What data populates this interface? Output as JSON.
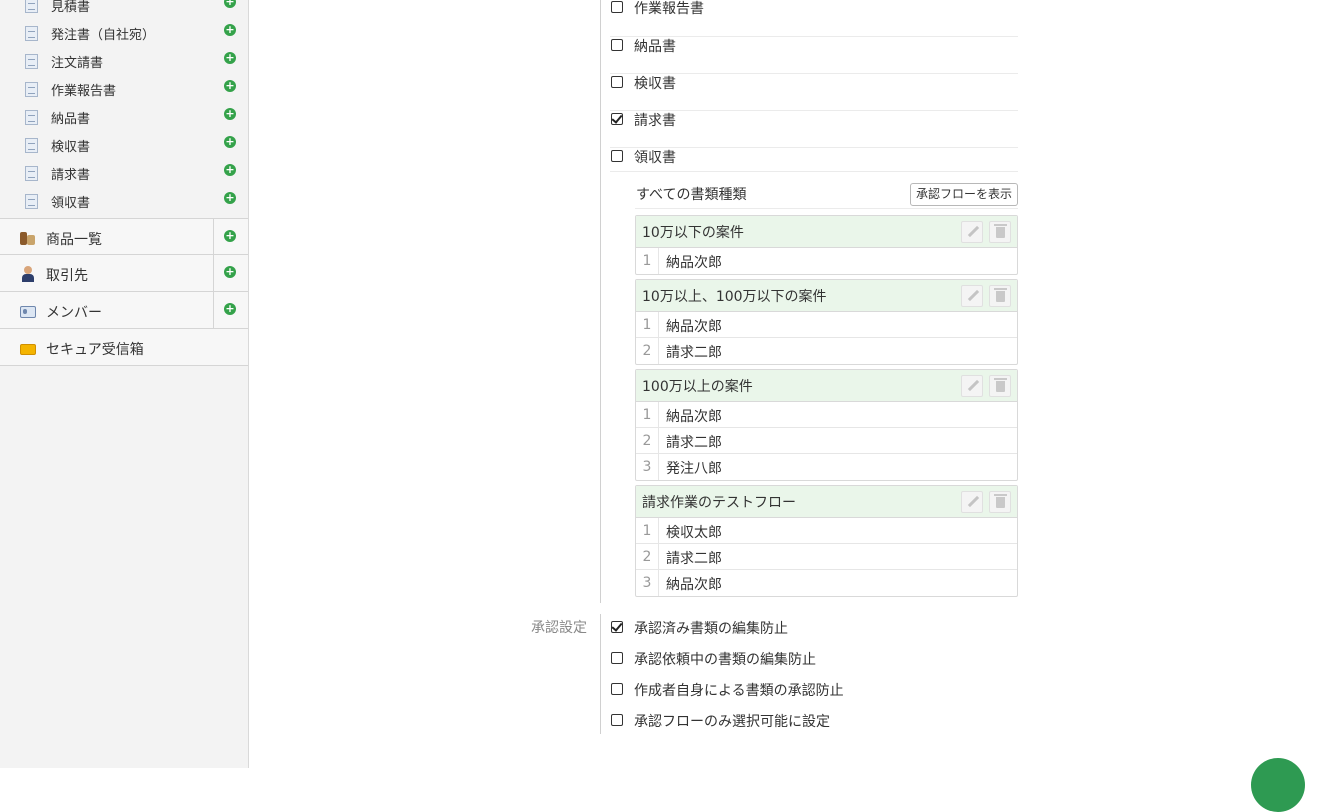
{
  "sidebar": {
    "doc_types": [
      {
        "label": "見積書"
      },
      {
        "label": "発注書（自社宛）"
      },
      {
        "label": "注文請書"
      },
      {
        "label": "作業報告書"
      },
      {
        "label": "納品書"
      },
      {
        "label": "検収書"
      },
      {
        "label": "請求書"
      },
      {
        "label": "領収書"
      }
    ],
    "nav": [
      {
        "label": "商品一覧",
        "icon": "products-icon"
      },
      {
        "label": "取引先",
        "icon": "client-person-icon"
      },
      {
        "label": "メンバー",
        "icon": "member-card-icon"
      },
      {
        "label": "セキュア受信箱",
        "icon": "envelope-icon"
      }
    ]
  },
  "doc_checks": [
    {
      "label": "作業報告書",
      "checked": false
    },
    {
      "label": "納品書",
      "checked": false
    },
    {
      "label": "検収書",
      "checked": false
    },
    {
      "label": "請求書",
      "checked": true
    },
    {
      "label": "領収書",
      "checked": false
    }
  ],
  "flows_section": {
    "all_types_label": "すべての書類種類",
    "show_flow_button": "承認フローを表示"
  },
  "flows": [
    {
      "name": "10万以下の案件",
      "steps": [
        {
          "num": "1",
          "person": "納品次郎"
        }
      ]
    },
    {
      "name": "10万以上、100万以下の案件",
      "steps": [
        {
          "num": "1",
          "person": "納品次郎"
        },
        {
          "num": "2",
          "person": "請求二郎"
        }
      ]
    },
    {
      "name": "100万以上の案件",
      "steps": [
        {
          "num": "1",
          "person": "納品次郎"
        },
        {
          "num": "2",
          "person": "請求二郎"
        },
        {
          "num": "3",
          "person": "発注八郎"
        }
      ]
    },
    {
      "name": "請求作業のテストフロー",
      "steps": [
        {
          "num": "1",
          "person": "検収太郎"
        },
        {
          "num": "2",
          "person": "請求二郎"
        },
        {
          "num": "3",
          "person": "納品次郎"
        }
      ]
    }
  ],
  "approval_settings": {
    "label": "承認設定",
    "options": [
      {
        "label": "承認済み書類の編集防止",
        "checked": true
      },
      {
        "label": "承認依頼中の書類の編集防止",
        "checked": false
      },
      {
        "label": "作成者自身による書類の承認防止",
        "checked": false
      },
      {
        "label": "承認フローのみ選択可能に設定",
        "checked": false
      }
    ]
  },
  "colors": {
    "accent_green": "#34a24a",
    "flow_header_bg": "#eaf6ea",
    "fab": "#2e9a52"
  }
}
